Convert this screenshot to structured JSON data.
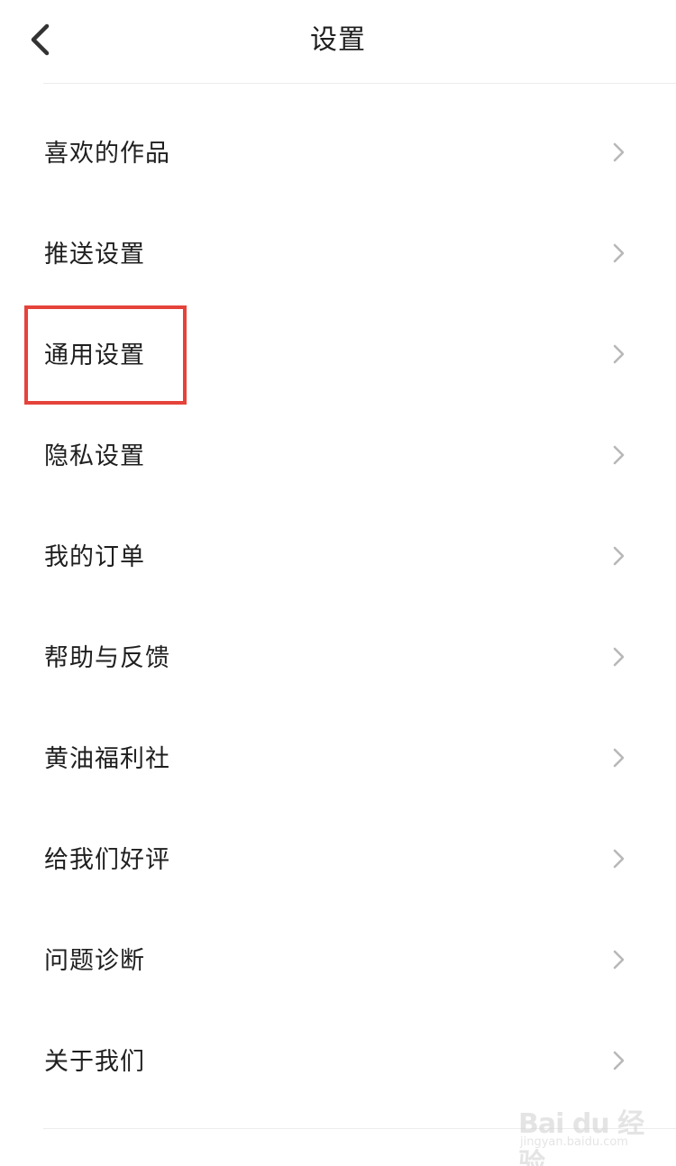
{
  "header": {
    "title": "设置"
  },
  "menu": {
    "items": [
      {
        "label": "喜欢的作品"
      },
      {
        "label": "推送设置"
      },
      {
        "label": "通用设置"
      },
      {
        "label": "隐私设置"
      },
      {
        "label": "我的订单"
      },
      {
        "label": "帮助与反馈"
      },
      {
        "label": "黄油福利社"
      },
      {
        "label": "给我们好评"
      },
      {
        "label": "问题诊断"
      },
      {
        "label": "关于我们"
      }
    ]
  },
  "annotation": {
    "highlight_color": "#e5433a",
    "highlighted_item": "通用设置"
  },
  "watermark": {
    "logo": "Bai du 经验",
    "site": "jingyan.baidu.com"
  },
  "icons": {
    "back": "chevron-left-icon",
    "row_arrow": "chevron-right-icon"
  }
}
